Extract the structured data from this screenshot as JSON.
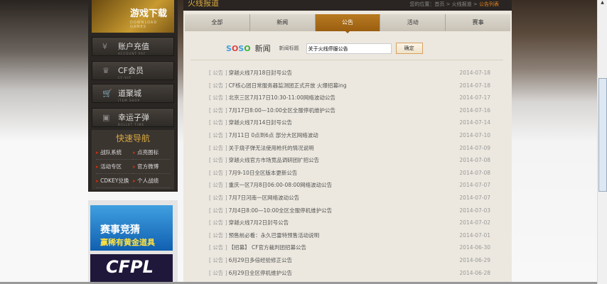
{
  "sidebar": {
    "download": {
      "title": "游戏下载",
      "sub": "DOWNLOAD GAMES"
    },
    "buttons": [
      {
        "label": "账户充值",
        "sub": "ACCOUNT PAY",
        "icon": "yen-icon"
      },
      {
        "label": "CF会员",
        "sub": "CF-VIP",
        "icon": "vip-icon"
      },
      {
        "label": "道聚城",
        "sub": "ITEM SHOP",
        "icon": "cart-icon"
      },
      {
        "label": "幸运子弹",
        "sub": "BULLET TIME",
        "icon": "gift-icon"
      }
    ],
    "quick_nav": {
      "title": "快速导航",
      "items": [
        "战队系统",
        "点亮图标",
        "活动专区",
        "官方微博",
        "CDKEY兑换",
        "个人战绩"
      ]
    },
    "ads": [
      {
        "title": "赛事竞猜",
        "sub": "赢稀有黄金道具"
      },
      {
        "title": "CFPL"
      }
    ]
  },
  "header": {
    "title": "火线报道",
    "breadcrumb": "您的位置：首页 > 火线报道 >",
    "current": "公告列表"
  },
  "tabs": [
    {
      "label": "全部"
    },
    {
      "label": "新闻"
    },
    {
      "label": "公告",
      "active": true
    },
    {
      "label": "活动"
    },
    {
      "label": "赛事"
    }
  ],
  "search": {
    "brand": "新闻",
    "label": "新闻标题",
    "value": "关于火线停服公告",
    "button": "确定"
  },
  "list": [
    {
      "cat": "[ 公告 ]",
      "title": "穿越火线7月18日封号公告",
      "date": "2014-07-18"
    },
    {
      "cat": "[ 公告 ]",
      "title": "CF核心团日常服务器监测团正式开放 火爆招募ing",
      "date": "2014-07-18"
    },
    {
      "cat": "[ 公告 ]",
      "title": "北京三区7月17日10:30-11:00网络波动公告",
      "date": "2014-07-17"
    },
    {
      "cat": "[ 公告 ]",
      "title": "7月17日8:00—10:00全区全服停机维护公告",
      "date": "2014-07-16"
    },
    {
      "cat": "[ 公告 ]",
      "title": "穿越火线7月14日封号公告",
      "date": "2014-07-14"
    },
    {
      "cat": "[ 公告 ]",
      "title": "7月11日 0点到6点 部分大区网络波动",
      "date": "2014-07-10"
    },
    {
      "cat": "[ 公告 ]",
      "title": "关于烧子弹无法使用枪托的情况说明",
      "date": "2014-07-09"
    },
    {
      "cat": "[ 公告 ]",
      "title": "穿越火线官方市场竞品调研团扩招公告",
      "date": "2014-07-08"
    },
    {
      "cat": "[ 公告 ]",
      "title": "7月9-10日全区版本更新公告",
      "date": "2014-07-08"
    },
    {
      "cat": "[ 公告 ]",
      "title": "重庆一区7月8日06:00-08:00网络波动公告",
      "date": "2014-07-07"
    },
    {
      "cat": "[ 公告 ]",
      "title": "7月7日河南一区网络波动公告",
      "date": "2014-07-07"
    },
    {
      "cat": "[ 公告 ]",
      "title": "7月4日8:00—10:00全区全服停机维护公告",
      "date": "2014-07-03"
    },
    {
      "cat": "[ 公告 ]",
      "title": "穿越火线7月2日封号公告",
      "date": "2014-07-02"
    },
    {
      "cat": "[ 公告 ]",
      "title": "预售前必看：永久巴雷特预售活动说明",
      "date": "2014-07-01"
    },
    {
      "cat": "[ 公告 ]",
      "title": "【招募】 CF官方裁判团招募公告",
      "date": "2014-06-30"
    },
    {
      "cat": "[ 公告 ]",
      "title": "6月29日多倍经验修正公告",
      "date": "2014-06-29"
    },
    {
      "cat": "[ 公告 ]",
      "title": "6月29日全区停机维护公告",
      "date": "2014-06-28"
    }
  ],
  "colors": {
    "accent": "#b07018",
    "sidebar_bg": "#2a2623",
    "content_bg": "#ece8df"
  }
}
